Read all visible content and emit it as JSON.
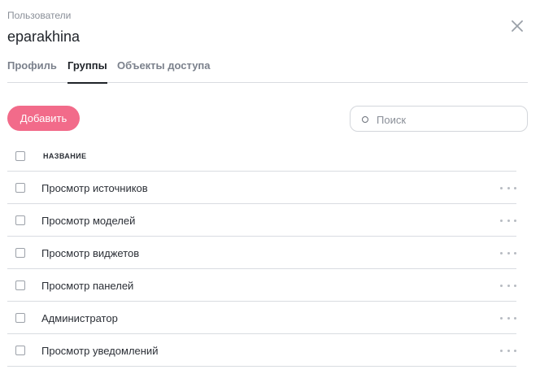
{
  "header": {
    "breadcrumb": "Пользователи",
    "title": "eparakhina",
    "close_icon": "close-icon"
  },
  "tabs": [
    {
      "label": "Профиль",
      "active": false
    },
    {
      "label": "Группы",
      "active": true
    },
    {
      "label": "Объекты доступа",
      "active": false
    }
  ],
  "toolbar": {
    "add_label": "Добавить",
    "search_placeholder": "Поиск",
    "search_value": ""
  },
  "table": {
    "column_name": "НАЗВАНИЕ",
    "rows": [
      {
        "name": "Просмотр источников"
      },
      {
        "name": "Просмотр моделей"
      },
      {
        "name": "Просмотр виджетов"
      },
      {
        "name": "Просмотр панелей"
      },
      {
        "name": "Администратор"
      },
      {
        "name": "Просмотр уведомлений"
      }
    ]
  },
  "colors": {
    "accent": "#f26b8a",
    "text": "#2b2f36",
    "muted": "#8a8f98",
    "divider": "#d9dce1"
  }
}
